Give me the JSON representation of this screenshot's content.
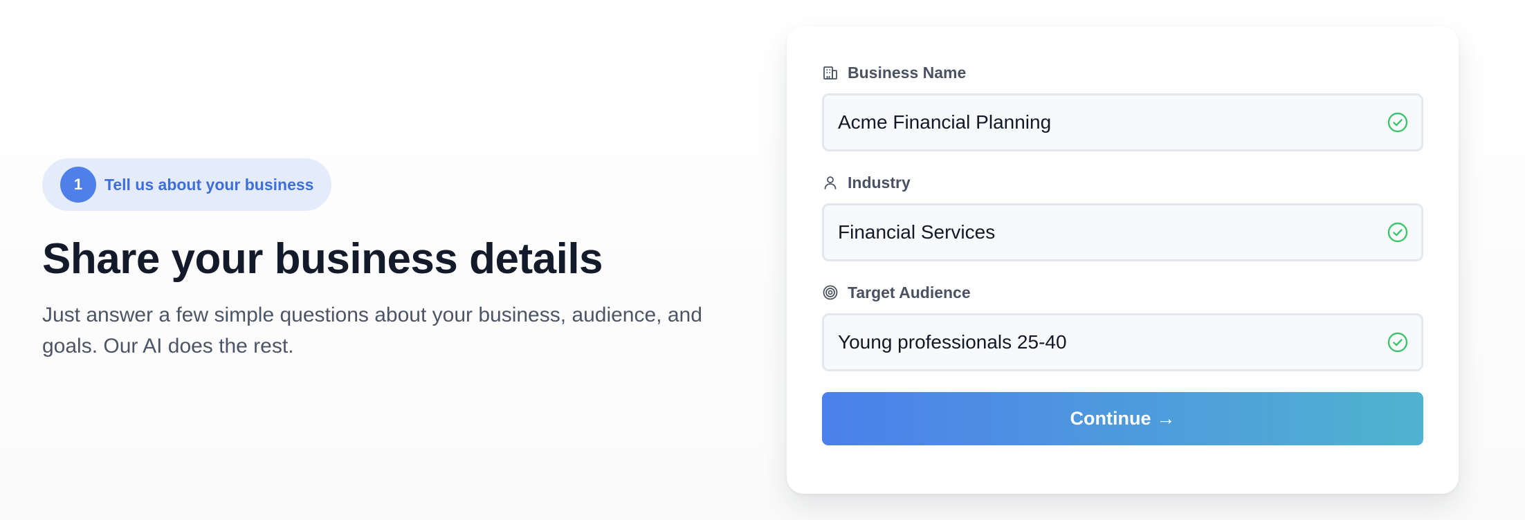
{
  "step": {
    "number": "1",
    "label": "Tell us about your business"
  },
  "headline": "Share your business details",
  "subtext": "Just answer a few simple questions about your business, audience, and goals. Our AI does the rest.",
  "form": {
    "fields": [
      {
        "label": "Business Name",
        "icon": "building-icon",
        "value": "Acme Financial Planning",
        "status": "valid"
      },
      {
        "label": "Industry",
        "icon": "user-icon",
        "value": "Financial Services",
        "status": "valid"
      },
      {
        "label": "Target Audience",
        "icon": "target-icon",
        "value": "Young professionals 25-40",
        "status": "valid"
      }
    ],
    "continue_label": "Continue",
    "continue_arrow": "→"
  },
  "colors": {
    "accent": "#4f80ea",
    "gradient_start": "#4c80ec",
    "gradient_end": "#50b3cf",
    "valid_check": "#3ec46d"
  }
}
